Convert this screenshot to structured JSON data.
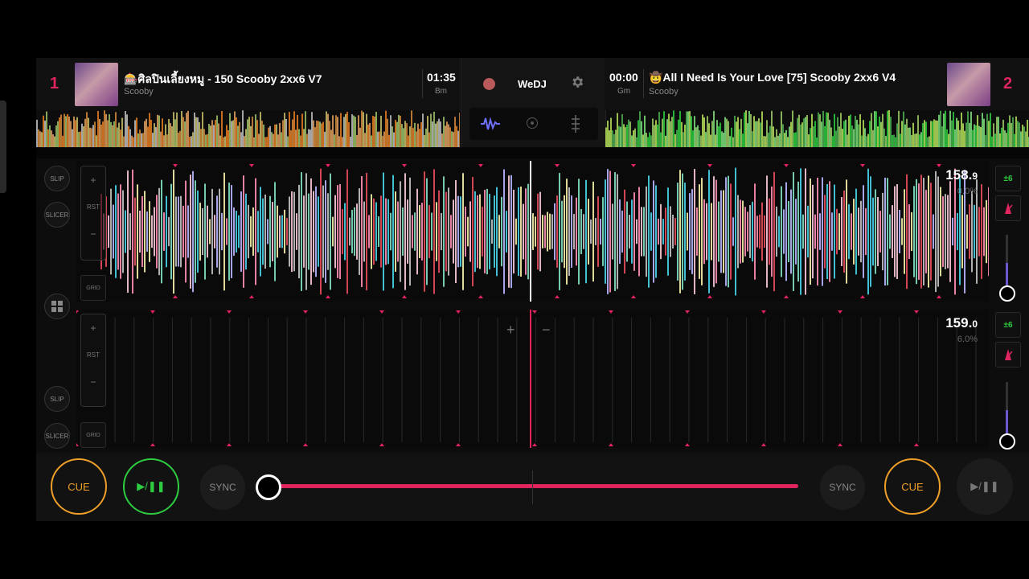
{
  "deck1": {
    "number": "1",
    "title": "🎰ศิลปินเลี้ยงหมู - 150 Scooby 2xx6 V7",
    "artist": "Scooby",
    "time": "01:35",
    "key": "Bm",
    "bpm_int": "158.",
    "bpm_dec": "9",
    "pitch": "0.0%"
  },
  "deck2": {
    "number": "2",
    "title": "🤠All I Need Is Your Love  [75] Scooby 2xx6 V4",
    "artist": "Scooby",
    "time": "00:00",
    "key": "Gm",
    "bpm_int": "159.",
    "bpm_dec": "0",
    "pitch": "6.0%"
  },
  "center": {
    "app_name": "WeDJ"
  },
  "side": {
    "slip": "SLIP",
    "slicer": "SLICER",
    "rst": "RST",
    "grid": "GRID",
    "plus": "+",
    "minus": "−",
    "pitch_range": "±6"
  },
  "transport": {
    "cue1": "CUE",
    "play1": "▶/❚❚",
    "sync1": "SYNC",
    "sync2": "SYNC",
    "cue2": "CUE",
    "play2": "▶/❚❚"
  },
  "crossfader": {
    "position": 0.0
  },
  "colors": {
    "accent": "#e0245e",
    "cue": "#f0a028",
    "play_active": "#2ecc40",
    "pitch_slider": "#6a5acd"
  },
  "icons": {
    "record": "record-icon",
    "settings": "gear-icon",
    "waveform_view": "waveform-icon",
    "vinyl_view": "vinyl-icon",
    "eq_view": "equalizer-icon",
    "key_lock": "metronome-icon",
    "layout": "grid-layout-icon"
  }
}
